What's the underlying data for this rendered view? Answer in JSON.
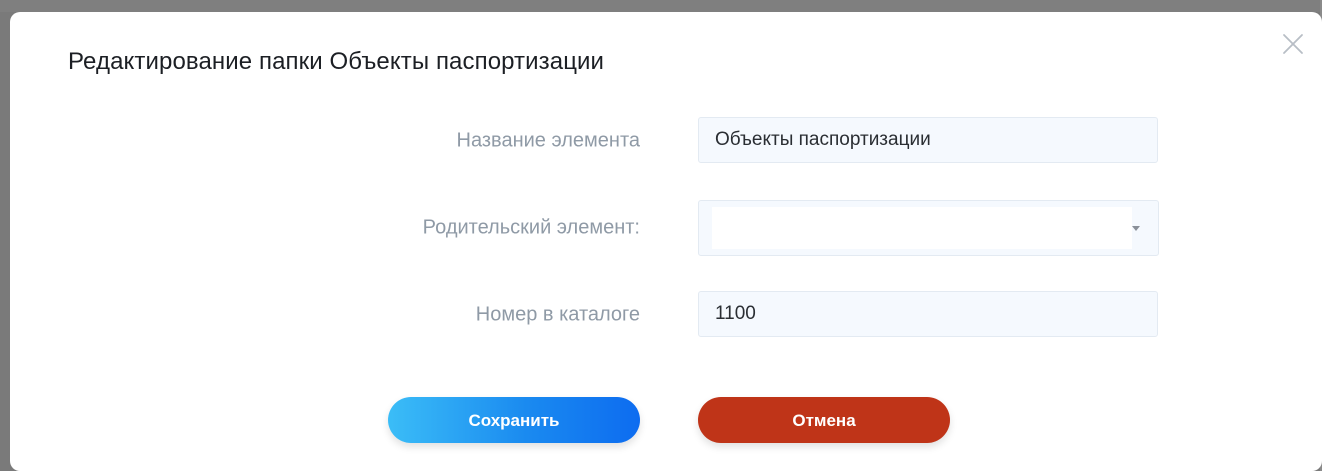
{
  "dialog": {
    "title": "Редактирование папки Объекты паспортизации",
    "close_icon": "close-icon"
  },
  "form": {
    "name_label": "Название элемента",
    "name_value": "Объекты паспортизации",
    "parent_label": "Родительский элемент:",
    "parent_value": "",
    "catalog_label": "Номер в каталоге",
    "catalog_value": "1100"
  },
  "actions": {
    "save_label": "Сохранить",
    "cancel_label": "Отмена"
  },
  "colors": {
    "save_gradient_start": "#3bbdf7",
    "save_gradient_end": "#0d6cf0",
    "cancel": "#bf3418",
    "label": "#8f9aa6",
    "input_bg": "#f5f9fe"
  }
}
